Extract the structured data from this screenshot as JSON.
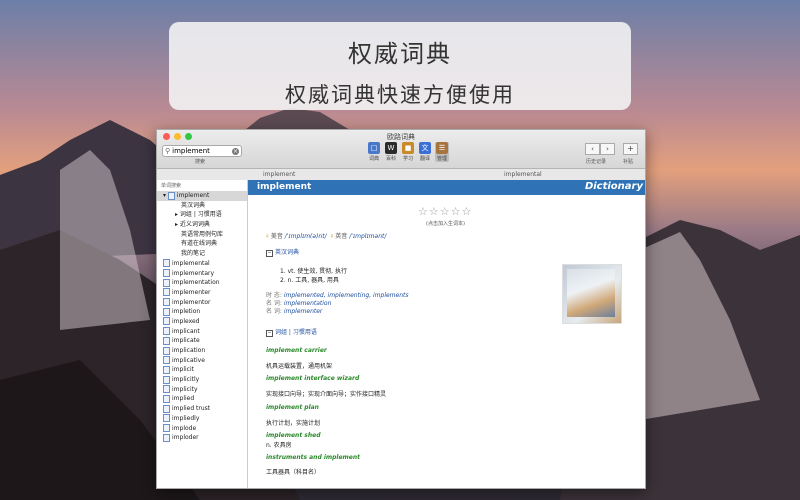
{
  "banner": {
    "title": "权威词典",
    "subtitle": "权威词典快速方便使用"
  },
  "window": {
    "title": "欧路词典",
    "search_value": "implement",
    "search_label": "搜索",
    "tools": [
      {
        "label": "词典",
        "color": "#4a78c9"
      },
      {
        "label": "百科",
        "color": "#2b2b2b"
      },
      {
        "label": "学习",
        "color": "#c98b2a"
      },
      {
        "label": "翻译",
        "color": "#3a6fd8"
      },
      {
        "label": "管理",
        "color": "#a6753f"
      }
    ],
    "history_label": "历史记录",
    "plus_label": "补贴",
    "tab_left": "implement",
    "tab_right": "implemental"
  },
  "sidebar": {
    "header": "单词搜索",
    "items": [
      "implement",
      "英汉词典",
      "词组 | 习惯用语",
      "近义词词典",
      "英语常用例句库",
      "有道在线词典",
      "我的笔记",
      "implemental",
      "implementary",
      "implementation",
      "implementer",
      "implementor",
      "impletion",
      "implexed",
      "implicant",
      "implicate",
      "implication",
      "implicative",
      "implicit",
      "implicitly",
      "implicity",
      "implied",
      "implied trust",
      "impliedly",
      "implode",
      "imploder"
    ]
  },
  "entry": {
    "word": "implement",
    "brand": "Dictionary",
    "stars": "☆☆☆☆☆",
    "star_note": "(点击加入生词本)",
    "pron_us_label": "美音",
    "pron_us": "/ˈɪmplɪm(ə)nt/",
    "pron_uk_label": "英音",
    "pron_uk": "/ˈɪmplɪmənt/",
    "sec1": "英汉词典",
    "defs": [
      "1.  vt. 使生效, 贯彻, 执行",
      "2.  n. 工具, 器具, 用具"
    ],
    "morph": [
      {
        "label": "时 态:",
        "value": "implemented, implementing, implements"
      },
      {
        "label": "名 词:",
        "value": "implementation"
      },
      {
        "label": "名 词:",
        "value": "implementer"
      }
    ],
    "sec2": "词组 | 习惯用语",
    "examples": [
      {
        "en": "implement carrier",
        "zh": "机具运载装置，通用机架"
      },
      {
        "en": "implement interface wizard",
        "zh": "实现接口向导；实现介面向导；实作接口精灵"
      },
      {
        "en": "implement plan",
        "zh": "执行计划，实施计划"
      },
      {
        "en": "implement shed",
        "zh": "n. 农具房"
      },
      {
        "en": "instruments and implement",
        "zh": "工具器具（科目名）"
      }
    ]
  }
}
